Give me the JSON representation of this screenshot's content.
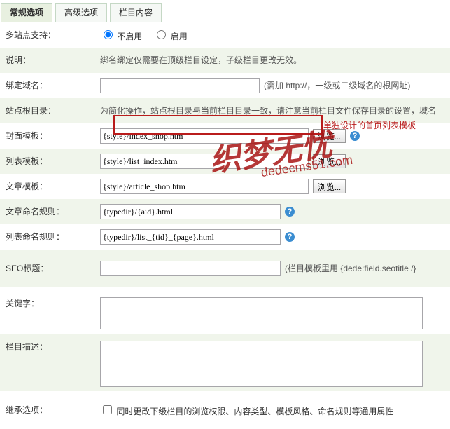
{
  "tabs": [
    "常规选项",
    "高级选项",
    "栏目内容"
  ],
  "rows": {
    "multisite": {
      "label": "多站点支持：",
      "opt1": "不启用",
      "opt2": "启用"
    },
    "desc": {
      "label": "说明：",
      "text": "绑名绑定仅需要在顶级栏目设定，子级栏目更改无效。"
    },
    "domain": {
      "label": "绑定域名：",
      "value": "",
      "hint": "(需加 http://，一级或二级域名的根网址)"
    },
    "siteroot": {
      "label": "站点根目录：",
      "text": "为简化操作，站点根目录与当前栏目目录一致，请注意当前栏目文件保存目录的设置，域名"
    },
    "cover": {
      "label": "封面模板：",
      "value": "{style}/index_shop.htm",
      "btn": "浏览..."
    },
    "list": {
      "label": "列表模板：",
      "value": "{style}/list_index.htm",
      "btn": "浏览..."
    },
    "article": {
      "label": "文章模板：",
      "value": "{style}/article_shop.htm",
      "btn": "浏览..."
    },
    "artrule": {
      "label": "文章命名规则：",
      "value": "{typedir}/{aid}.html"
    },
    "listrule": {
      "label": "列表命名规则：",
      "value": "{typedir}/list_{tid}_{page}.html"
    },
    "seo": {
      "label": "SEO标题：",
      "value": "",
      "hint": "(栏目模板里用 {dede:field.seotitle /}"
    },
    "keywords": {
      "label": "关键字："
    },
    "catdesc": {
      "label": "栏目描述："
    },
    "inherit": {
      "label": "继承选项：",
      "text": "同时更改下级栏目的浏览权限、内容类型、模板风格、命名规则等通用属性"
    }
  },
  "annotation": "单独设计的首页列表模板",
  "watermark": {
    "main": "织梦无忧",
    "sub": "dedecms51.com"
  }
}
